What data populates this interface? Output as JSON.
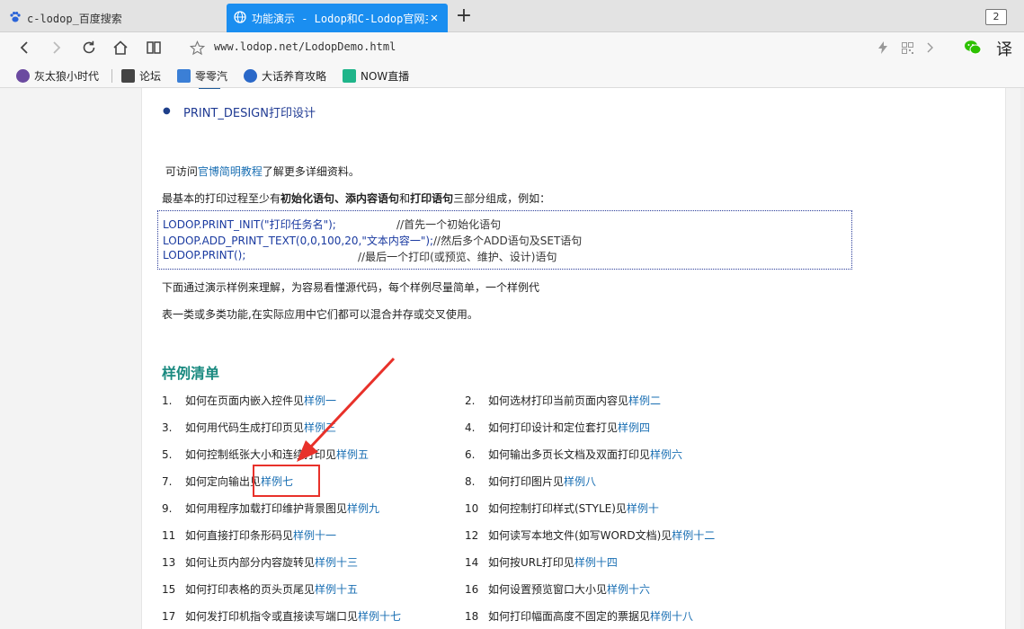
{
  "tabs": [
    {
      "title": "c-lodop_百度搜索",
      "active": false
    },
    {
      "title": "功能演示 - Lodop和C-Lodop官网主站",
      "active": true
    }
  ],
  "tab_count": "2",
  "address": {
    "url": "www.lodop.net/LodopDemo.html"
  },
  "toolbar": {
    "translate_label": "译"
  },
  "bookmarks": [
    {
      "label": "灰太狼小时代",
      "color": "#6b4aa0"
    },
    {
      "label": "论坛",
      "color": "#444444"
    },
    {
      "label": "零零汽",
      "color": "#3b7fd6"
    },
    {
      "label": "大话养育攻略",
      "color": "#2a68c8"
    },
    {
      "label": "NOW直播",
      "color": "#1fb58a"
    }
  ],
  "content": {
    "bullet": "PRINT_DESIGN打印设计",
    "visit_prefix": "可访问",
    "visit_link": "官博简明教程",
    "visit_suffix": "了解更多详细资料。",
    "basic_prefix": "最基本的打印过程至少有",
    "basic_b1": "初始化语句",
    "basic_sep": "、",
    "basic_b2": "添内容语句",
    "basic_and": "和",
    "basic_b3": "打印语句",
    "basic_suffix": "三部分组成，例如：",
    "code": [
      {
        "text": "LODOP.PRINT_INIT(\"打印任务名\");",
        "comment": "//首先一个初始化语句"
      },
      {
        "text": "LODOP.ADD_PRINT_TEXT(0,0,100,20,\"文本内容一\");",
        "comment": "//然后多个ADD语句及SET语句"
      },
      {
        "text": "LODOP.PRINT();",
        "comment": "//最后一个打印(或预览、维护、设计)语句"
      }
    ],
    "desc1": "下面通过演示样例来理解，为容易看懂源代码，每个样例尽量简单，一个样例代",
    "desc2": "表一类或多类功能,在实际应用中它们都可以混合并存或交叉使用。",
    "section_title": "样例清单"
  },
  "samples": [
    {
      "num": "1.",
      "text": "如何在页面内嵌入控件见",
      "link": "样例一"
    },
    {
      "num": "2.",
      "text": "如何选材打印当前页面内容见",
      "link": "样例二"
    },
    {
      "num": "3.",
      "text": "如何用代码生成打印页见",
      "link": "样例三"
    },
    {
      "num": "4.",
      "text": "如何打印设计和定位套打见",
      "link": "样例四"
    },
    {
      "num": "5.",
      "text": "如何控制纸张大小和连续打印见",
      "link": "样例五"
    },
    {
      "num": "6.",
      "text": "如何输出多页长文档及双面打印见",
      "link": "样例六"
    },
    {
      "num": "7.",
      "text": "如何定向输出见",
      "link": "样例七"
    },
    {
      "num": "8.",
      "text": "如何打印图片见",
      "link": "样例八"
    },
    {
      "num": "9.",
      "text": "如何用程序加载打印维护背景图见",
      "link": "样例九"
    },
    {
      "num": "10",
      "text": "如何控制打印样式(STYLE)见",
      "link": "样例十"
    },
    {
      "num": "11",
      "text": "如何直接打印条形码见",
      "link": "样例十一"
    },
    {
      "num": "12",
      "text": "如何读写本地文件(如写WORD文档)见",
      "link": "样例十二"
    },
    {
      "num": "13",
      "text": "如何让页内部分内容旋转见",
      "link": "样例十三"
    },
    {
      "num": "14",
      "text": "如何按URL打印见",
      "link": "样例十四"
    },
    {
      "num": "15",
      "text": "如何打印表格的页头页尾见",
      "link": "样例十五"
    },
    {
      "num": "16",
      "text": "如何设置预览窗口大小见",
      "link": "样例十六"
    },
    {
      "num": "17",
      "text": "如何发打印机指令或直接读写端口见",
      "link": "样例十七"
    },
    {
      "num": "18",
      "text": "如何打印幅面高度不固定的票据见",
      "link": "样例十八"
    }
  ],
  "colors": {
    "accent": "#1a8ef0",
    "link": "#1a6fb3",
    "section": "#1a8a80",
    "annotation": "#e8312a"
  }
}
